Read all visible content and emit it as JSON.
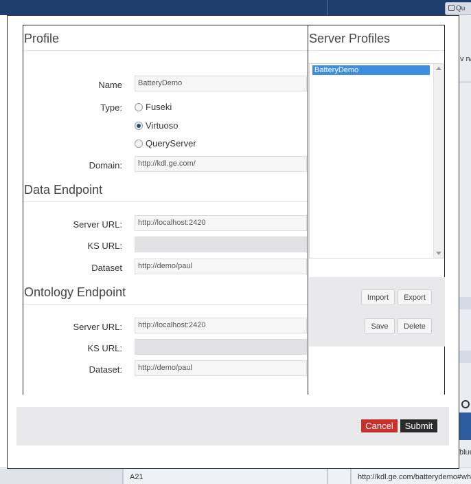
{
  "background": {
    "top_button_label": "Qu",
    "right_text": "v na",
    "right_text2": "blue",
    "bottom_cell_1": "A21",
    "bottom_cell_2": "http://kdl.ge.com/batterydemo#whi"
  },
  "profile": {
    "title": "Profile",
    "name_label": "Name",
    "name_value": "BatteryDemo",
    "type_label": "Type:",
    "type_options": [
      "Fuseki",
      "Virtuoso",
      "QueryServer"
    ],
    "type_selected": "Virtuoso",
    "domain_label": "Domain:",
    "domain_value": "http://kdl.ge.com/"
  },
  "data_endpoint": {
    "title": "Data Endpoint",
    "server_url_label": "Server URL:",
    "server_url_value": "http://localhost:2420",
    "ks_url_label": "KS URL:",
    "ks_url_value": "",
    "dataset_label": "Dataset",
    "dataset_value": "http://demo/paul"
  },
  "ontology_endpoint": {
    "title": "Ontology Endpoint",
    "server_url_label": "Server URL:",
    "server_url_value": "http://localhost:2420",
    "ks_url_label": "KS URL:",
    "ks_url_value": "",
    "dataset_label": "Dataset:",
    "dataset_value": "http://demo/paul"
  },
  "server_profiles": {
    "title": "Server Profiles",
    "items": [
      "BatteryDemo"
    ],
    "selected": "BatteryDemo",
    "import_label": "Import",
    "export_label": "Export",
    "save_label": "Save",
    "delete_label": "Delete"
  },
  "footer": {
    "cancel_label": "Cancel",
    "submit_label": "Submit"
  },
  "colors": {
    "cancel": "#c9302c",
    "submit": "#2b2b2b",
    "selection": "#3d8ee0",
    "app_header": "#1e3d6e"
  }
}
